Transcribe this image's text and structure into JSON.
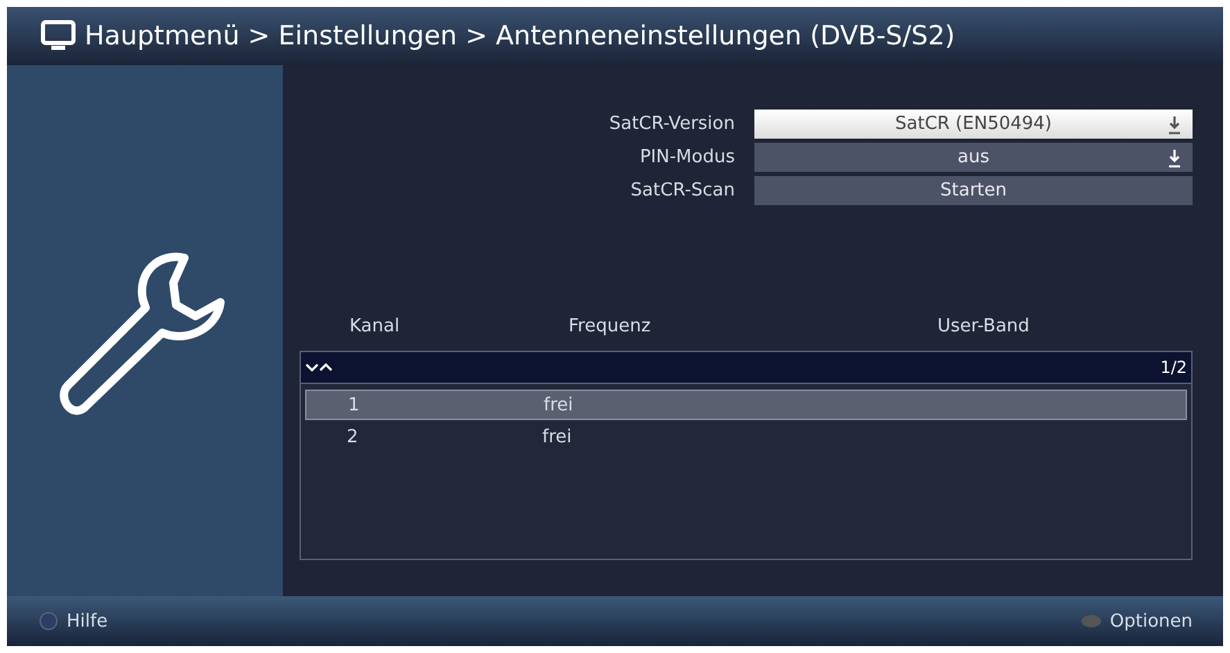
{
  "header": {
    "breadcrumb": "Hauptmenü > Einstellungen > Antenneneinstellungen (DVB-S/S2)"
  },
  "settings": [
    {
      "label": "SatCR-Version",
      "value": "SatCR (EN50494)",
      "kind": "select",
      "selected": true
    },
    {
      "label": "PIN-Modus",
      "value": "aus",
      "kind": "select",
      "selected": false
    },
    {
      "label": "SatCR-Scan",
      "value": "Starten",
      "kind": "action",
      "selected": false
    }
  ],
  "table": {
    "columns": [
      "Kanal",
      "Frequenz",
      "User-Band"
    ],
    "page": "1/2",
    "rows": [
      {
        "cells": [
          "1",
          "frei"
        ],
        "selected": true
      },
      {
        "cells": [
          "2",
          "frei"
        ],
        "selected": false
      }
    ]
  },
  "footer": [
    {
      "label": "Hilfe",
      "kind": "round"
    },
    {
      "label": "Optionen",
      "kind": "key"
    }
  ]
}
